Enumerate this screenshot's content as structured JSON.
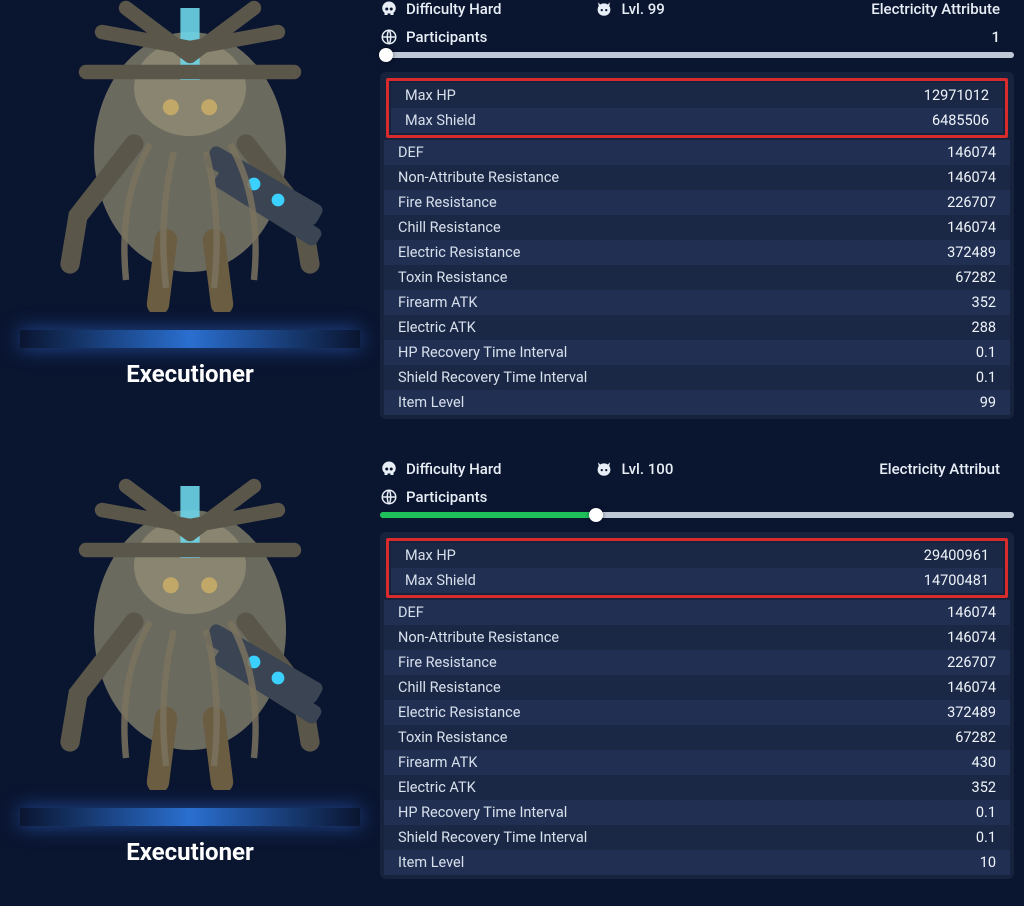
{
  "top": {
    "title": "Executioner",
    "difficulty": {
      "label": "Difficulty Hard",
      "icon": "skull-icon"
    },
    "level": {
      "label": "Lvl. 99",
      "icon": "demon-icon"
    },
    "attribute": {
      "label": "Electricity Attribute"
    },
    "participants": {
      "label": "Participants",
      "value": "1",
      "icon": "globe-icon",
      "slider_percent": 1,
      "slider_color": "white"
    },
    "highlight_stats": [
      {
        "label": "Max HP",
        "value": "12971012"
      },
      {
        "label": "Max Shield",
        "value": "6485506"
      }
    ],
    "stats": [
      {
        "label": "DEF",
        "value": "146074"
      },
      {
        "label": "Non-Attribute Resistance",
        "value": "146074"
      },
      {
        "label": "Fire Resistance",
        "value": "226707"
      },
      {
        "label": "Chill Resistance",
        "value": "146074"
      },
      {
        "label": "Electric Resistance",
        "value": "372489"
      },
      {
        "label": "Toxin Resistance",
        "value": "67282"
      },
      {
        "label": "Firearm ATK",
        "value": "352"
      },
      {
        "label": "Electric ATK",
        "value": "288"
      },
      {
        "label": "HP Recovery Time Interval",
        "value": "0.1"
      },
      {
        "label": "Shield Recovery Time Interval",
        "value": "0.1"
      },
      {
        "label": "Item Level",
        "value": "99"
      }
    ]
  },
  "bottom": {
    "title": "Executioner",
    "difficulty": {
      "label": "Difficulty Hard",
      "icon": "skull-icon"
    },
    "level": {
      "label": "Lvl. 100",
      "icon": "demon-icon"
    },
    "attribute": {
      "label": "Electricity Attribut"
    },
    "participants": {
      "label": "Participants",
      "value": "",
      "icon": "globe-icon",
      "slider_percent": 34,
      "slider_color": "green"
    },
    "highlight_stats": [
      {
        "label": "Max HP",
        "value": "29400961"
      },
      {
        "label": "Max Shield",
        "value": "14700481"
      }
    ],
    "stats": [
      {
        "label": "DEF",
        "value": "146074"
      },
      {
        "label": "Non-Attribute Resistance",
        "value": "146074"
      },
      {
        "label": "Fire Resistance",
        "value": "226707"
      },
      {
        "label": "Chill Resistance",
        "value": "146074"
      },
      {
        "label": "Electric Resistance",
        "value": "372489"
      },
      {
        "label": "Toxin Resistance",
        "value": "67282"
      },
      {
        "label": "Firearm ATK",
        "value": "430"
      },
      {
        "label": "Electric ATK",
        "value": "352"
      },
      {
        "label": "HP Recovery Time Interval",
        "value": "0.1"
      },
      {
        "label": "Shield Recovery Time Interval",
        "value": "0.1"
      },
      {
        "label": "Item Level",
        "value": "10"
      }
    ]
  }
}
